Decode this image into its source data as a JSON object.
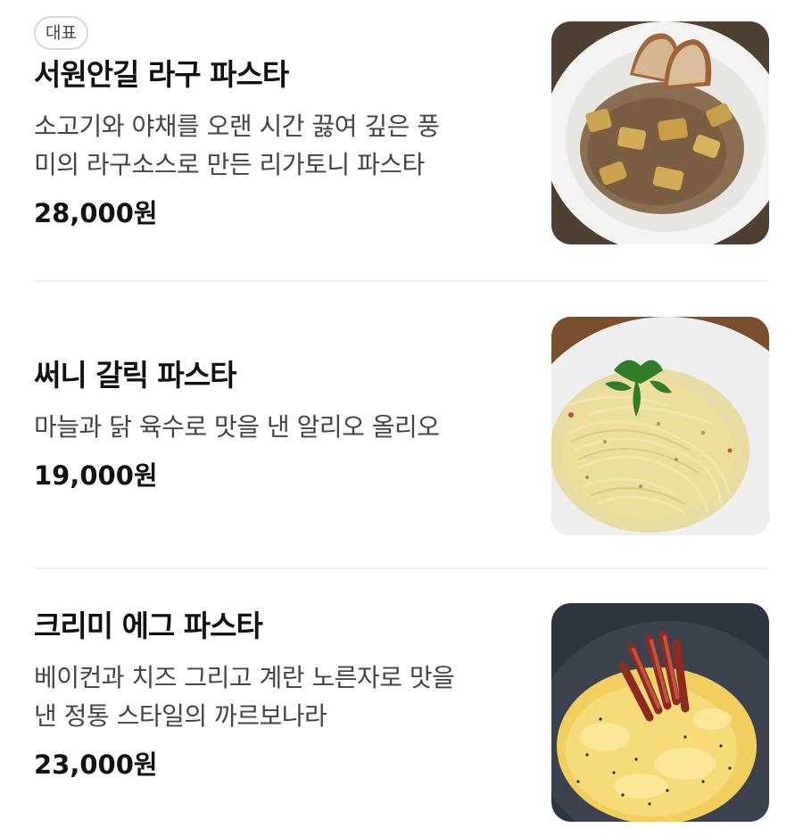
{
  "menu": {
    "items": [
      {
        "badge": "대표",
        "name": "서원안길 라구 파스타",
        "description_lines": [
          "소고기와 야채를 오랜 시간 끓여 깊은 풍",
          "미의 라구소스로 만든 리가토니 파스타"
        ],
        "price": "28,000원"
      },
      {
        "name": "써니 갈릭 파스타",
        "description_lines": [
          "마늘과 닭 육수로 맛을 낸 알리오 올리오"
        ],
        "price": "19,000원"
      },
      {
        "name": "크리미 에그 파스타",
        "description_lines": [
          "베이컨과 치즈 그리고 계란 노른자로 맛을",
          "낸 정통 스타일의 까르보나라"
        ],
        "price": "23,000원"
      }
    ]
  },
  "colors": {
    "text_primary": "#111111",
    "text_secondary": "#444444",
    "badge_border": "#d8d8d8",
    "divider": "#f0f0f0"
  }
}
